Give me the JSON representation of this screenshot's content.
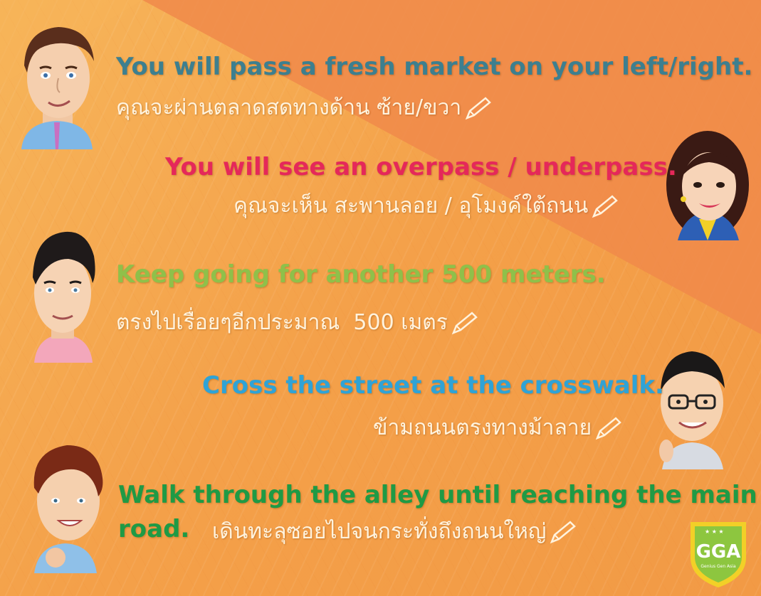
{
  "colors": {
    "phrase1": "#3d7f8f",
    "phrase2": "#e5285a",
    "phrase3": "#8fc04a",
    "phrase4": "#2fa3d6",
    "phrase5": "#1f9a45",
    "thai_text": "#fff3de",
    "logo_green": "#8dc63f",
    "logo_yellow": "#f2d027"
  },
  "phrases": [
    {
      "en": "You will pass a fresh market on your left/right.",
      "th": "คุณจะผ่านตลาดสดทางด้าน ซ้าย/ขวา",
      "icon": "pencil-icon"
    },
    {
      "en": "You will see an overpass / underpass.",
      "th": "คุณจะเห็น สะพานลอย / อุโมงค์ใต้ถนน",
      "icon": "pencil-icon"
    },
    {
      "en": "Keep going for another 500 meters.",
      "th": "ตรงไปเรื่อยๆอีกประมาณ  500 เมตร",
      "icon": "pencil-icon"
    },
    {
      "en": "Cross the street at the crosswalk.",
      "th": "ข้ามถนนตรงทางม้าลาย",
      "icon": "pencil-icon"
    },
    {
      "en_line1": "Walk through the alley until reaching the main",
      "en_line2": "road.",
      "th": "เดินทะลุซอยไปจนกระทั่งถึงถนนใหญ่",
      "icon": "pencil-icon"
    }
  ],
  "logo": {
    "letters": "GGA",
    "caption": "Genius Gen Asia"
  }
}
